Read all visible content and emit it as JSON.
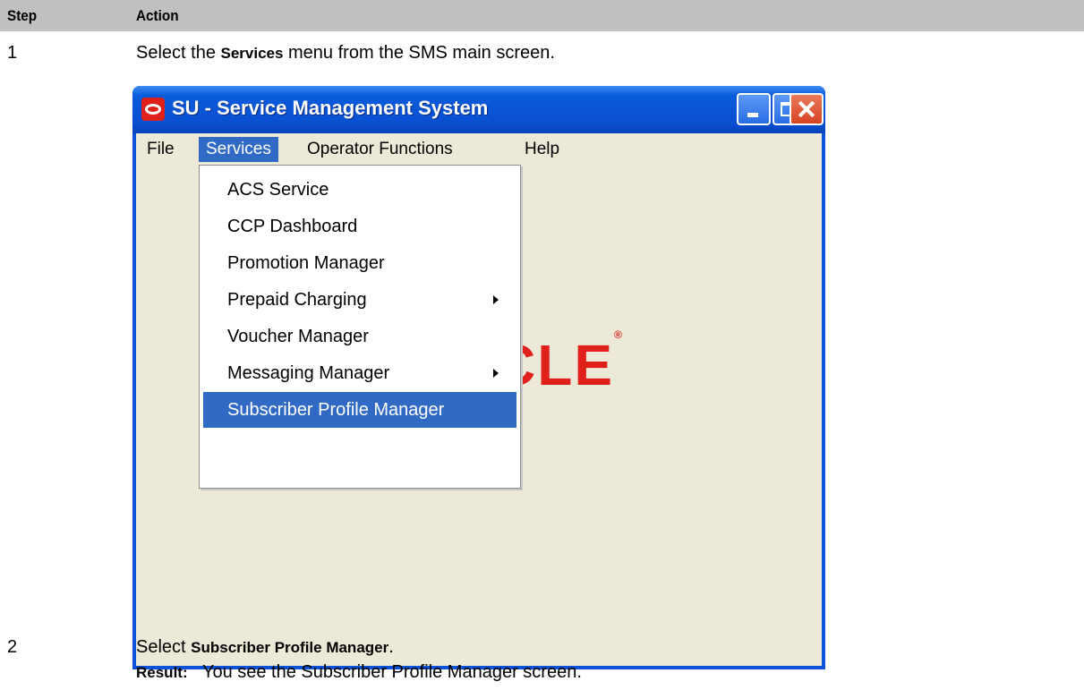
{
  "table": {
    "col_step": "Step",
    "col_action": "Action"
  },
  "step1": {
    "number": "1",
    "text_before": "Select the ",
    "text_bold": "Services",
    "text_after": " menu from the SMS main screen."
  },
  "window": {
    "title": "SU - Service Management System",
    "menu": [
      "File",
      "Services",
      "Operator Functions",
      "Help"
    ],
    "active_menu": "Services",
    "logo_text": "CLE",
    "logo_mark": "®",
    "dropdown": [
      {
        "label": "ACS Service",
        "submenu": false
      },
      {
        "label": "CCP Dashboard",
        "submenu": false
      },
      {
        "label": "Promotion Manager",
        "submenu": false
      },
      {
        "label": "Prepaid Charging",
        "submenu": true
      },
      {
        "label": "Voucher Manager",
        "submenu": false
      },
      {
        "label": "Messaging Manager",
        "submenu": true
      },
      {
        "label": "Subscriber Profile Manager",
        "submenu": false,
        "selected": true
      }
    ]
  },
  "step2": {
    "number": "2",
    "text_before": "Select ",
    "text_bold": "Subscriber Profile Manager",
    "text_after": ".",
    "result_label": "Result:",
    "result_text": "You see the Subscriber Profile Manager screen."
  }
}
